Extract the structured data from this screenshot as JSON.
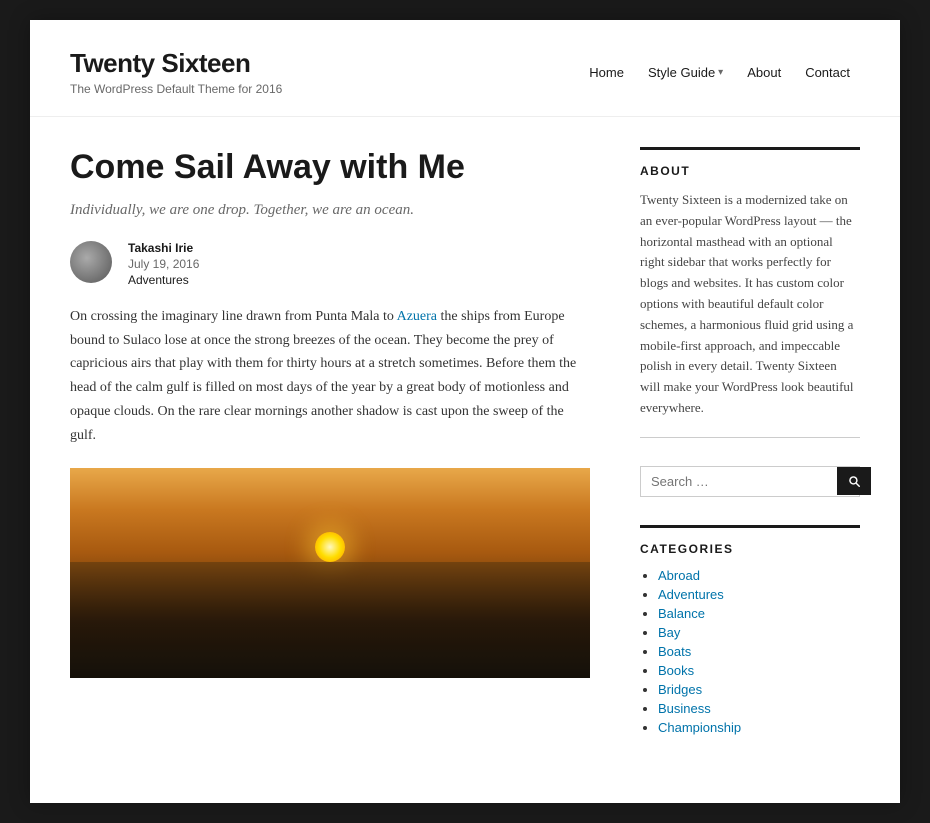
{
  "site": {
    "title": "Twenty Sixteen",
    "description": "The WordPress Default Theme for 2016"
  },
  "nav": {
    "items": [
      {
        "label": "Home",
        "link": "#"
      },
      {
        "label": "Style Guide",
        "link": "#",
        "hasDropdown": true
      },
      {
        "label": "About",
        "link": "#"
      },
      {
        "label": "Contact",
        "link": "#"
      }
    ]
  },
  "post": {
    "title": "Come Sail Away with Me",
    "tagline": "Individually, we are one drop. Together, we are an ocean.",
    "author": "Takashi Irie",
    "date": "July 19, 2016",
    "category": "Adventures",
    "body_part1": "On crossing the imaginary line drawn from Punta Mala to ",
    "link_text": "Azuera",
    "body_part2": " the ships from Europe bound to Sulaco lose at once the strong breezes of the ocean. They become the prey of capricious airs that play with them for thirty hours at a stretch sometimes. Before them the head of the calm gulf is filled on most days of the year by a great body of motionless and opaque clouds. On the rare clear mornings another shadow is cast upon the sweep of the gulf."
  },
  "sidebar": {
    "about_heading": "ABOUT",
    "about_text": "Twenty Sixteen is a modernized take on an ever-popular WordPress layout — the horizontal masthead with an optional right sidebar that works perfectly for blogs and websites. It has custom color options with beautiful default color schemes, a harmonious fluid grid using a mobile-first approach, and impeccable polish in every detail. Twenty Sixteen will make your WordPress look beautiful everywhere.",
    "search_placeholder": "Search …",
    "categories_heading": "CATEGORIES",
    "categories": [
      {
        "label": "Abroad"
      },
      {
        "label": "Adventures"
      },
      {
        "label": "Balance"
      },
      {
        "label": "Bay"
      },
      {
        "label": "Boats"
      },
      {
        "label": "Books"
      },
      {
        "label": "Bridges"
      },
      {
        "label": "Business"
      },
      {
        "label": "Championship"
      }
    ]
  }
}
